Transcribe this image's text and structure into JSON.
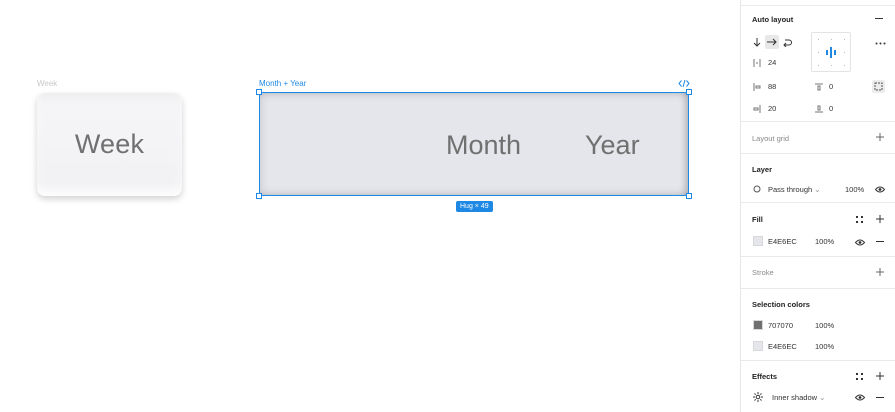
{
  "canvas": {
    "week_frame_label": "Week",
    "week_text": "Week",
    "selected_frame_label": "Month + Year",
    "month_text": "Month",
    "year_text": "Year",
    "hug_badge": "Hug × 49"
  },
  "panel": {
    "auto_layout": {
      "title": "Auto layout",
      "item_spacing": "24",
      "padding_horizontal": "88",
      "padding_vertical": "20",
      "padding_top": "0",
      "padding_bottom": "0"
    },
    "layout_grid": {
      "title": "Layout grid"
    },
    "layer": {
      "title": "Layer",
      "blend_mode": "Pass through",
      "opacity": "100%"
    },
    "fill": {
      "title": "Fill",
      "hex": "E4E6EC",
      "opacity": "100%",
      "color": "#E4E6EC"
    },
    "stroke": {
      "title": "Stroke"
    },
    "selection_colors": {
      "title": "Selection colors",
      "items": [
        {
          "hex": "707070",
          "opacity": "100%",
          "color": "#707070"
        },
        {
          "hex": "E4E6EC",
          "opacity": "100%",
          "color": "#E4E6EC"
        }
      ]
    },
    "effects": {
      "title": "Effects",
      "effect": "Inner shadow"
    }
  }
}
